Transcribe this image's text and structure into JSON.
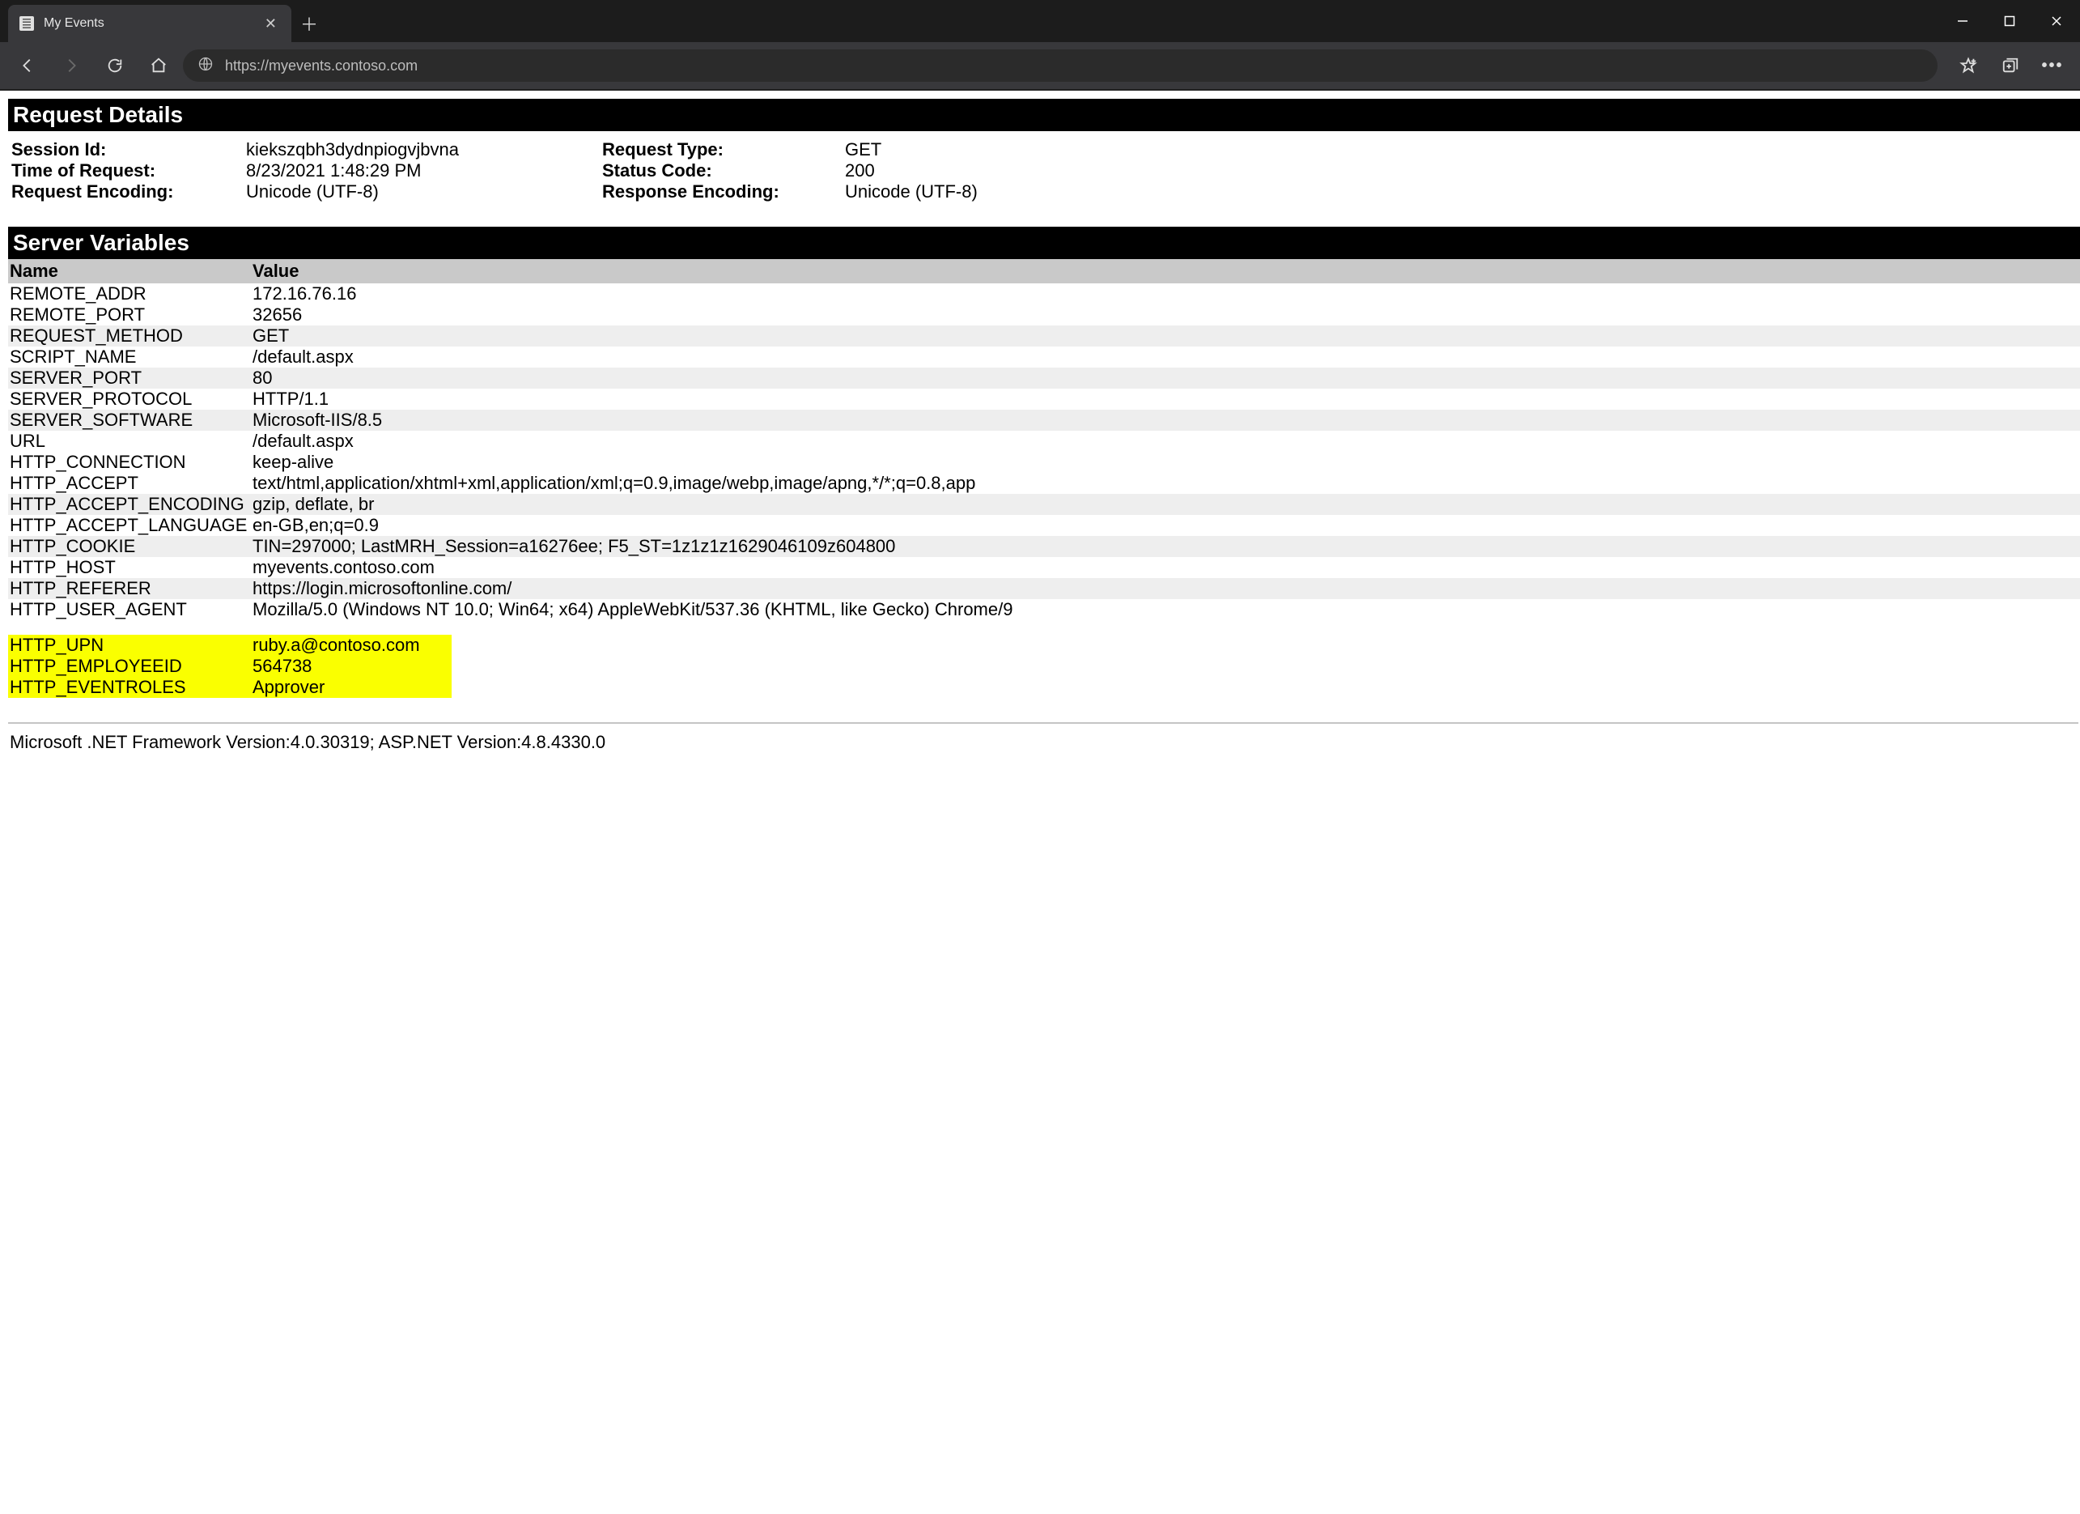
{
  "browser": {
    "tab_title": "My Events",
    "url": "https://myevents.contoso.com"
  },
  "request_details": {
    "heading": "Request Details",
    "labels": {
      "session_id": "Session Id:",
      "request_type": "Request Type:",
      "time_of_request": "Time of Request:",
      "status_code": "Status Code:",
      "request_encoding": "Request Encoding:",
      "response_encoding": "Response Encoding:"
    },
    "values": {
      "session_id": "kiekszqbh3dydnpiogvjbvna",
      "request_type": "GET",
      "time_of_request": "8/23/2021 1:48:29 PM",
      "status_code": "200",
      "request_encoding": "Unicode (UTF-8)",
      "response_encoding": "Unicode (UTF-8)"
    }
  },
  "server_variables": {
    "heading": "Server Variables",
    "col_name": "Name",
    "col_value": "Value",
    "rows": [
      {
        "name": "REMOTE_ADDR",
        "value": "172.16.76.16"
      },
      {
        "name": "REMOTE_PORT",
        "value": "32656"
      },
      {
        "name": "REQUEST_METHOD",
        "value": "GET"
      },
      {
        "name": "SCRIPT_NAME",
        "value": "/default.aspx"
      },
      {
        "name": "SERVER_PORT",
        "value": "80"
      },
      {
        "name": "SERVER_PROTOCOL",
        "value": "HTTP/1.1"
      },
      {
        "name": "SERVER_SOFTWARE",
        "value": "Microsoft-IIS/8.5"
      },
      {
        "name": "URL",
        "value": "/default.aspx"
      },
      {
        "name": "HTTP_CONNECTION",
        "value": "keep-alive"
      },
      {
        "name": "HTTP_ACCEPT",
        "value": "text/html,application/xhtml+xml,application/xml;q=0.9,image/webp,image/apng,*/*;q=0.8,app"
      },
      {
        "name": "HTTP_ACCEPT_ENCODING",
        "value": "gzip, deflate, br"
      },
      {
        "name": "HTTP_ACCEPT_LANGUAGE",
        "value": "en-GB,en;q=0.9"
      },
      {
        "name": "HTTP_COOKIE",
        "value": "TIN=297000; LastMRH_Session=a16276ee; F5_ST=1z1z1z1629046109z604800"
      },
      {
        "name": "HTTP_HOST",
        "value": "myevents.contoso.com"
      },
      {
        "name": "HTTP_REFERER",
        "value": "https://login.microsoftonline.com/"
      },
      {
        "name": "HTTP_USER_AGENT",
        "value": "Mozilla/5.0 (Windows NT 10.0; Win64; x64) AppleWebKit/537.36 (KHTML, like Gecko) Chrome/9"
      }
    ],
    "highlighted": [
      {
        "name": "HTTP_UPN",
        "value": "ruby.a@contoso.com"
      },
      {
        "name": "HTTP_EMPLOYEEID",
        "value": "564738"
      },
      {
        "name": "HTTP_EVENTROLES",
        "value": "Approver"
      }
    ]
  },
  "footer": "Microsoft .NET Framework Version:4.0.30319; ASP.NET Version:4.8.4330.0"
}
